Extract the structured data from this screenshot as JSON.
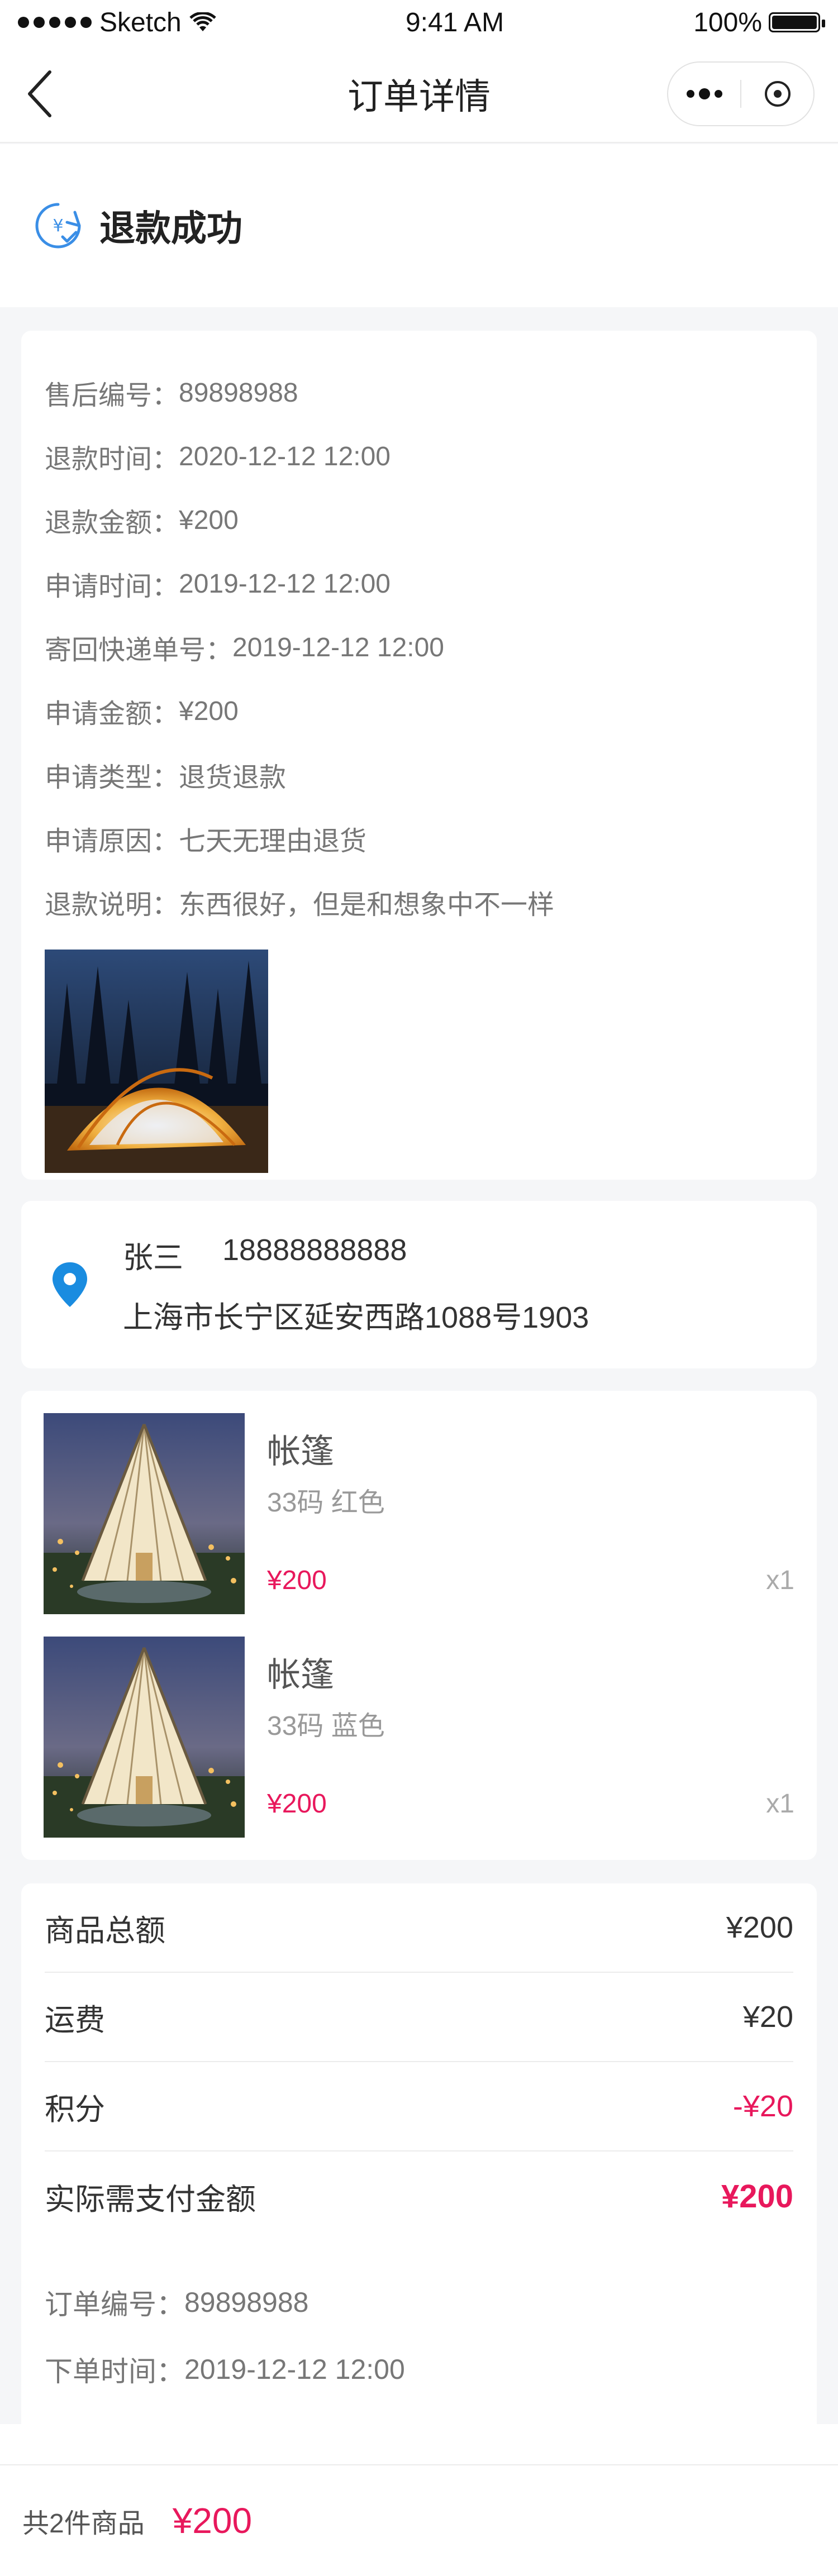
{
  "status_bar": {
    "carrier": "Sketch",
    "time": "9:41 AM",
    "battery": "100%"
  },
  "nav": {
    "title": "订单详情"
  },
  "refund_status": {
    "text": "退款成功"
  },
  "after_sale": {
    "rows": [
      {
        "label": "售后编号：",
        "value": "89898988"
      },
      {
        "label": "退款时间：",
        "value": "2020-12-12 12:00"
      },
      {
        "label": "退款金额：",
        "value": "¥200"
      },
      {
        "label": "申请时间：",
        "value": "2019-12-12 12:00"
      },
      {
        "label": "寄回快递单号： ",
        "value": "2019-12-12 12:00"
      },
      {
        "label": "申请金额：",
        "value": "¥200"
      },
      {
        "label": "申请类型：",
        "value": "退货退款"
      },
      {
        "label": "申请原因：",
        "value": "七天无理由退货"
      },
      {
        "label": "退款说明：",
        "value": "东西很好，但是和想象中不一样"
      }
    ]
  },
  "address": {
    "name": "张三",
    "phone": "18888888888",
    "detail": "上海市长宁区延安西路1088号1903"
  },
  "goods": [
    {
      "name": "帐篷",
      "spec": "33码 红色",
      "price": "¥200",
      "qty": "x1"
    },
    {
      "name": "帐篷",
      "spec": "33码 蓝色",
      "price": "¥200",
      "qty": "x1"
    }
  ],
  "summary": {
    "rows": [
      {
        "label": "商品总额",
        "value": "¥200"
      },
      {
        "label": "运费",
        "value": "¥20"
      },
      {
        "label": "积分",
        "value": "-¥20"
      },
      {
        "label": "实际需支付金额",
        "value": "¥200"
      }
    ],
    "order_no_label": "订单编号：",
    "order_no": "89898988",
    "order_time_label": "下单时间：",
    "order_time": "2019-12-12 12:00"
  },
  "footer": {
    "count_label": "共2件商品",
    "total": "¥200"
  },
  "colors": {
    "accent_red": "#e8185c",
    "pin_blue": "#1a8ce0",
    "icon_blue": "#3a8ee6"
  }
}
